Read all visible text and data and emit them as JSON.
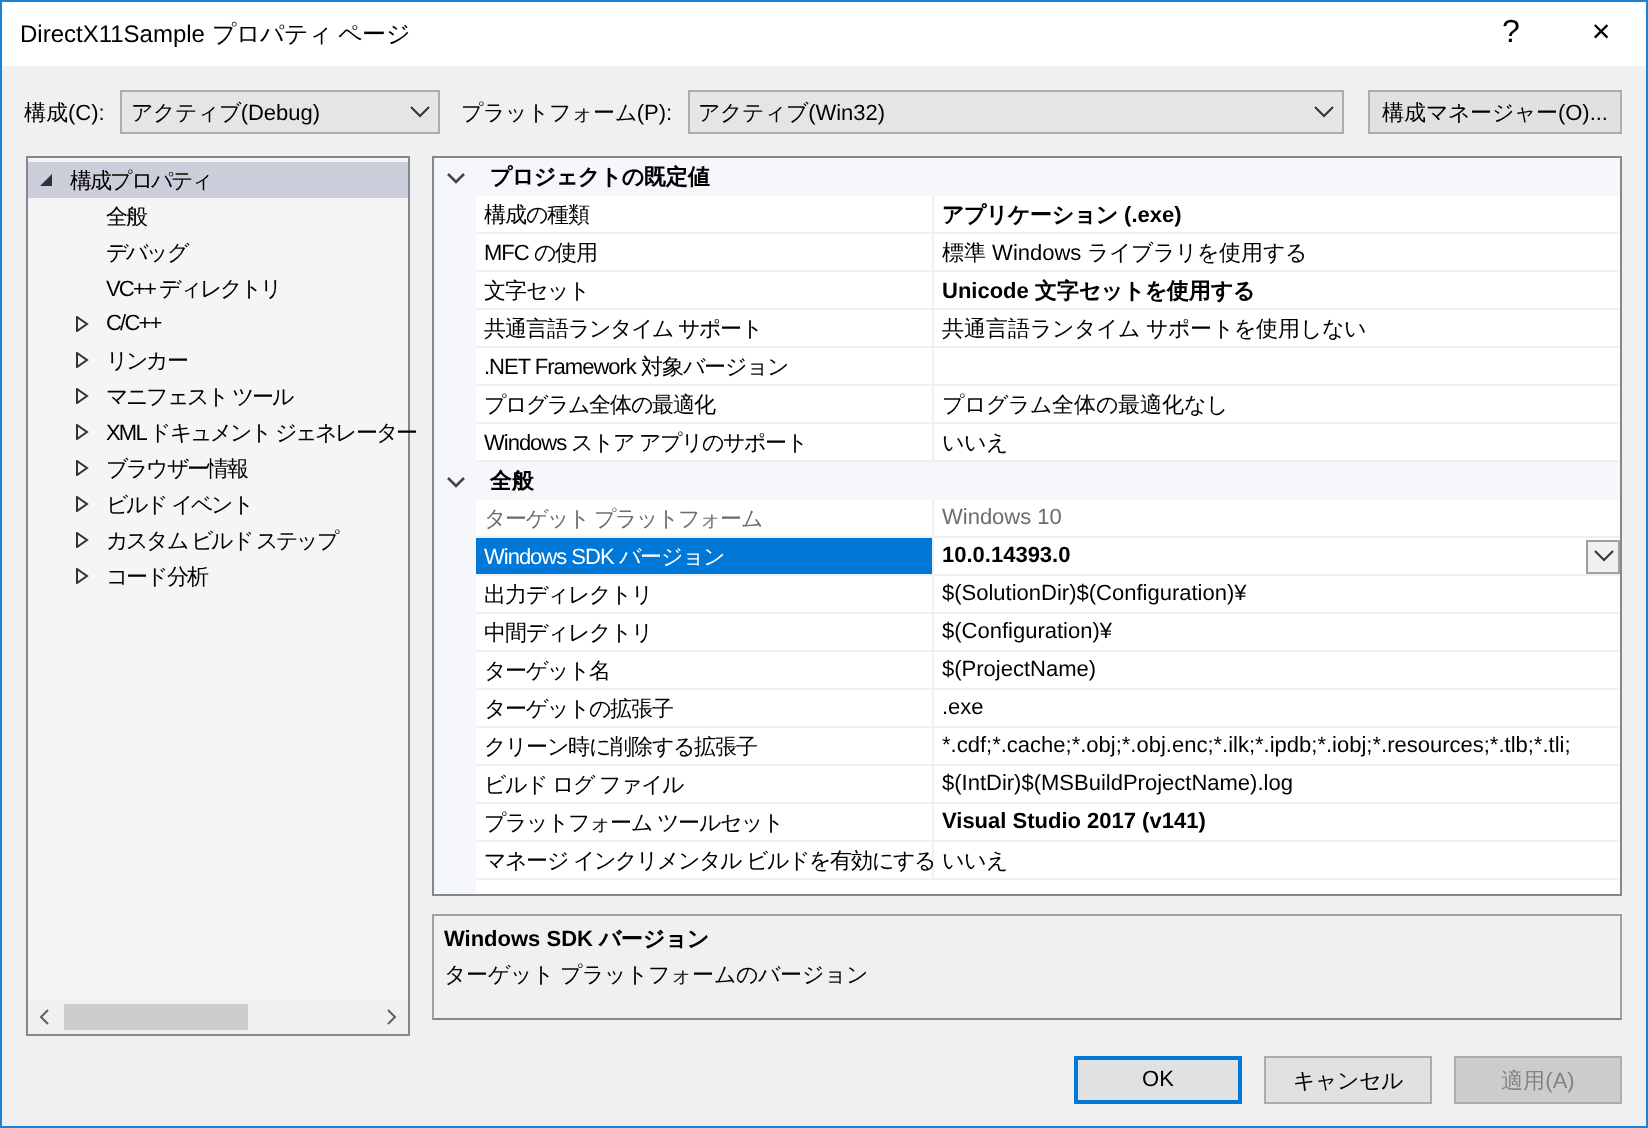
{
  "window": {
    "title": "DirectX11Sample プロパティ ページ",
    "help": "?",
    "close": "×"
  },
  "toolbar": {
    "configuration": {
      "label": "構成(C):",
      "value": "アクティブ(Debug)"
    },
    "platform": {
      "label": "プラットフォーム(P):",
      "value": "アクティブ(Win32)"
    },
    "manager_button": "構成マネージャー(O)..."
  },
  "tree": [
    {
      "label": "構成プロパティ",
      "kind": "folder",
      "expanded": true,
      "selected": true,
      "children": [
        {
          "label": "全般",
          "kind": "leaf",
          "selected": false
        },
        {
          "label": "デバッグ",
          "kind": "leaf",
          "selected": false
        },
        {
          "label": "VC++ ディレクトリ",
          "kind": "leaf",
          "selected": false
        },
        {
          "label": "C/C++",
          "kind": "folder",
          "expanded": false,
          "selected": false
        },
        {
          "label": "リンカー",
          "kind": "folder",
          "expanded": false,
          "selected": false
        },
        {
          "label": "マニフェスト ツール",
          "kind": "folder",
          "expanded": false,
          "selected": false
        },
        {
          "label": "XML ドキュメント ジェネレーター",
          "kind": "folder",
          "expanded": false,
          "selected": false
        },
        {
          "label": "ブラウザー情報",
          "kind": "folder",
          "expanded": false,
          "selected": false
        },
        {
          "label": "ビルド イベント",
          "kind": "folder",
          "expanded": false,
          "selected": false
        },
        {
          "label": "カスタム ビルド ステップ",
          "kind": "folder",
          "expanded": false,
          "selected": false
        },
        {
          "label": "コード分析",
          "kind": "folder",
          "expanded": false,
          "selected": false
        }
      ]
    }
  ],
  "grid": [
    {
      "category": "プロジェクトの既定値",
      "expanded": true,
      "rows": [
        {
          "name": "構成の種類",
          "value": "アプリケーション (.exe)",
          "modified": true,
          "disabled": false,
          "selected": false
        },
        {
          "name": "MFC の使用",
          "value": "標準 Windows ライブラリを使用する",
          "modified": false,
          "disabled": false,
          "selected": false
        },
        {
          "name": "文字セット",
          "value": "Unicode 文字セットを使用する",
          "modified": true,
          "disabled": false,
          "selected": false
        },
        {
          "name": "共通言語ランタイム サポート",
          "value": "共通言語ランタイム サポートを使用しない",
          "modified": false,
          "disabled": false,
          "selected": false
        },
        {
          "name": ".NET Framework 対象バージョン",
          "modified": false,
          "disabled": false,
          "selected": false
        },
        {
          "name": "プログラム全体の最適化",
          "value": "プログラム全体の最適化なし",
          "modified": false,
          "disabled": false,
          "selected": false
        },
        {
          "name": "Windows ストア アプリのサポート",
          "value": "いいえ",
          "modified": false,
          "disabled": false,
          "selected": false
        }
      ]
    },
    {
      "category": "全般",
      "expanded": true,
      "rows": [
        {
          "name": "ターゲット プラットフォーム",
          "value": "Windows 10",
          "modified": false,
          "disabled": true,
          "selected": false
        },
        {
          "name": "Windows SDK バージョン",
          "value": "10.0.14393.0",
          "modified": true,
          "disabled": false,
          "selected": true
        },
        {
          "name": "出力ディレクトリ",
          "value": "$(SolutionDir)$(Configuration)¥",
          "modified": false,
          "disabled": false,
          "selected": false
        },
        {
          "name": "中間ディレクトリ",
          "value": "$(Configuration)¥",
          "modified": false,
          "disabled": false,
          "selected": false
        },
        {
          "name": "ターゲット名",
          "value": "$(ProjectName)",
          "modified": false,
          "disabled": false,
          "selected": false
        },
        {
          "name": "ターゲットの拡張子",
          "value": ".exe",
          "modified": false,
          "disabled": false,
          "selected": false
        },
        {
          "name": "クリーン時に削除する拡張子",
          "value": "*.cdf;*.cache;*.obj;*.obj.enc;*.ilk;*.ipdb;*.iobj;*.resources;*.tlb;*.tli;",
          "modified": false,
          "disabled": false,
          "selected": false
        },
        {
          "name": "ビルド ログ ファイル",
          "value": "$(IntDir)$(MSBuildProjectName).log",
          "modified": false,
          "disabled": false,
          "selected": false
        },
        {
          "name": "プラットフォーム ツールセット",
          "value": "Visual Studio 2017 (v141)",
          "modified": true,
          "disabled": false,
          "selected": false
        },
        {
          "name": "マネージ インクリメンタル ビルドを有効にする",
          "value": "いいえ",
          "modified": false,
          "disabled": false,
          "selected": false
        }
      ]
    }
  ],
  "description": {
    "title": "Windows SDK バージョン",
    "text": "ターゲット プラットフォームのバージョン"
  },
  "buttons": [
    {
      "label": "OK",
      "kind": "default",
      "disabled": false
    },
    {
      "label": "キャンセル",
      "kind": "normal",
      "disabled": false
    },
    {
      "label": "適用(A)",
      "kind": "normal",
      "disabled": true
    }
  ]
}
